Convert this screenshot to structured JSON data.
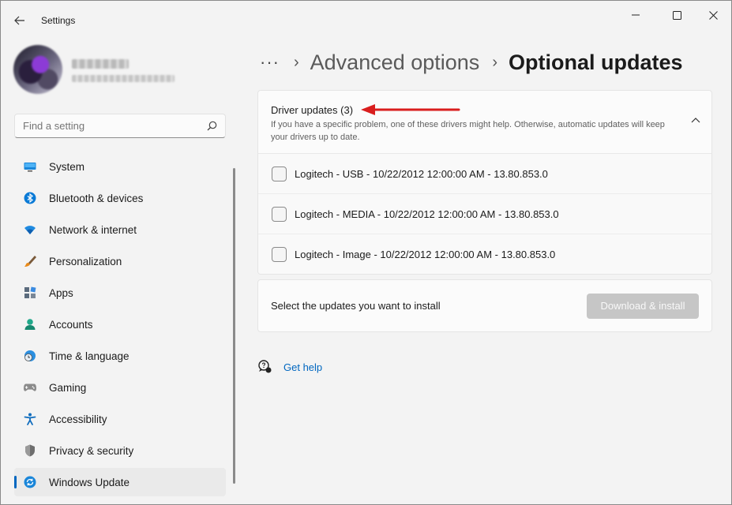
{
  "window": {
    "title": "Settings"
  },
  "breadcrumb": {
    "more": "···",
    "parent": "Advanced options",
    "current": "Optional updates"
  },
  "search": {
    "placeholder": "Find a setting"
  },
  "sidebar": {
    "items": [
      {
        "label": "System",
        "icon": "monitor-icon",
        "color": "#0078d4"
      },
      {
        "label": "Bluetooth & devices",
        "icon": "bluetooth-icon",
        "color": "#0078d4"
      },
      {
        "label": "Network & internet",
        "icon": "wifi-icon",
        "color": "#0078d4"
      },
      {
        "label": "Personalization",
        "icon": "brush-icon",
        "color": "#e88a1a"
      },
      {
        "label": "Apps",
        "icon": "apps-icon",
        "color": "#5b6b7d"
      },
      {
        "label": "Accounts",
        "icon": "person-icon",
        "color": "#20a88a"
      },
      {
        "label": "Time & language",
        "icon": "globe-clock-icon",
        "color": "#0078d4"
      },
      {
        "label": "Gaming",
        "icon": "gamepad-icon",
        "color": "#7a7a7a"
      },
      {
        "label": "Accessibility",
        "icon": "accessibility-icon",
        "color": "#0f6cbd"
      },
      {
        "label": "Privacy & security",
        "icon": "shield-icon",
        "color": "#6e6e6e"
      },
      {
        "label": "Windows Update",
        "icon": "update-icon",
        "color": "#0078d4",
        "selected": true
      }
    ]
  },
  "driver_updates": {
    "title": "Driver updates (3)",
    "description": "If you have a specific problem, one of these drivers might help. Otherwise, automatic updates will keep your drivers up to date.",
    "items": [
      {
        "label": "Logitech - USB - 10/22/2012 12:00:00 AM - 13.80.853.0",
        "checked": false
      },
      {
        "label": "Logitech - MEDIA - 10/22/2012 12:00:00 AM - 13.80.853.0",
        "checked": false
      },
      {
        "label": "Logitech - Image - 10/22/2012 12:00:00 AM - 13.80.853.0",
        "checked": false
      }
    ]
  },
  "install": {
    "prompt": "Select the updates you want to install",
    "button_label": "Download & install",
    "button_enabled": false
  },
  "help": {
    "label": "Get help"
  },
  "colors": {
    "accent": "#0067c0",
    "annotation_arrow": "#d91e1e",
    "disabled_button": "#c6c6c6"
  }
}
